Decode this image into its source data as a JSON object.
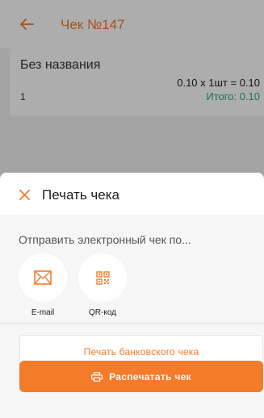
{
  "appbar": {
    "title": "Чек №147"
  },
  "receipt": {
    "name": "Без названия",
    "formula": "0.10 x 1шт = 0.10",
    "qty": "1",
    "total": "Итого: 0.10"
  },
  "sheet": {
    "title": "Печать чека",
    "send_label": "Отправить электронный чек по...",
    "share": [
      {
        "label": "E-mail",
        "icon": "envelope-icon"
      },
      {
        "label": "QR-код",
        "icon": "qr-code-icon"
      }
    ],
    "bank_button": "Печать банковского чека",
    "print_button": "Распечатать чек"
  },
  "colors": {
    "accent": "#f47b2a",
    "total": "#2aa88b"
  }
}
